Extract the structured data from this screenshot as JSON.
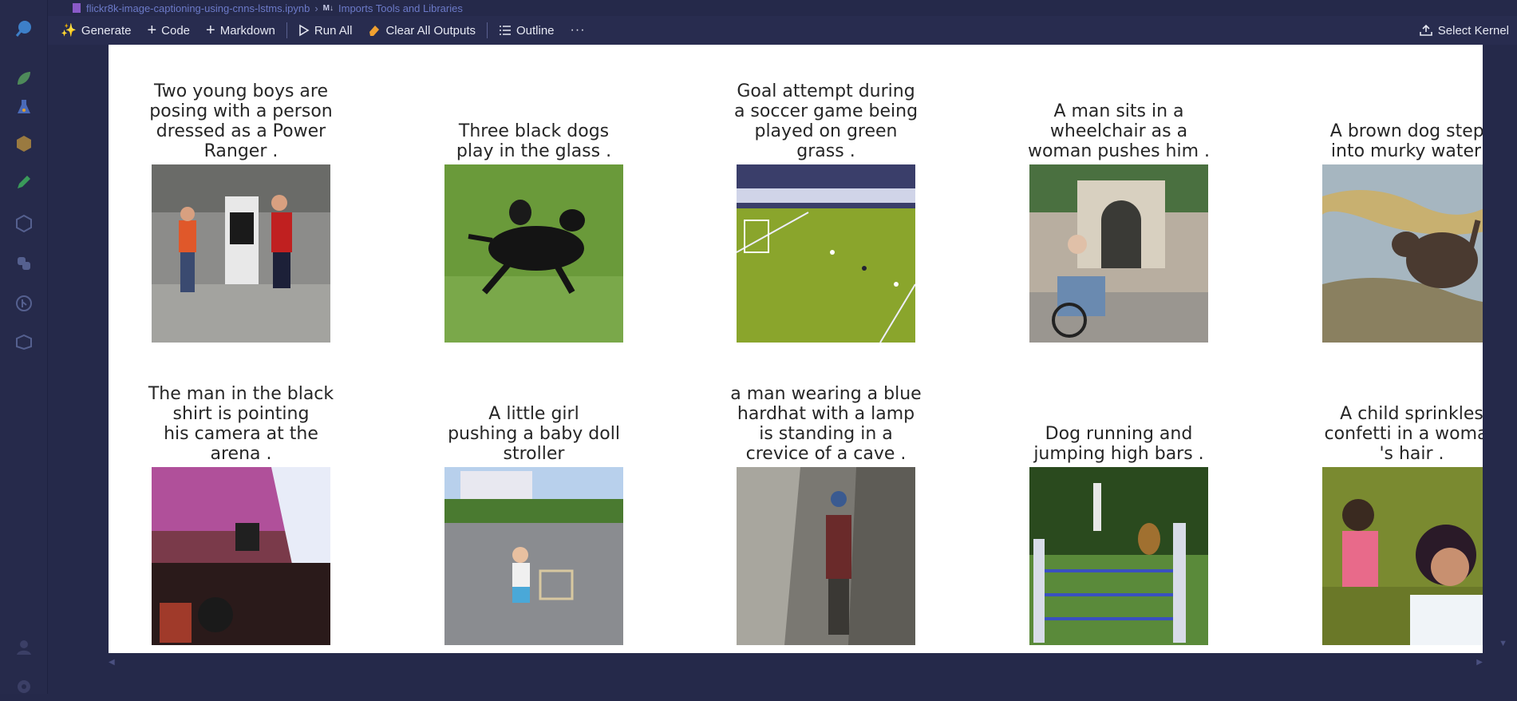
{
  "breadcrumb": {
    "file": "flickr8k-image-captioning-using-cnns-lstms.ipynb",
    "badge": "M↓",
    "section": "Imports Tools and Libraries"
  },
  "toolbar": {
    "generate": "Generate",
    "code": "Code",
    "markdown": "Markdown",
    "run_all": "Run All",
    "clear_outputs": "Clear All Outputs",
    "outline": "Outline",
    "more": "···",
    "select_kernel": "Select Kernel"
  },
  "captions": [
    "Two young boys are posing with a person dressed as a Power Ranger .",
    "Three black dogs play in the glass .",
    "Goal attempt during a soccer game being played on green grass .",
    "A man sits in a wheelchair as a woman pushes him .",
    "A brown dog steps into murky water .",
    "The man in the black shirt is pointing his camera at the arena .",
    "A little girl pushing a baby doll stroller",
    "a man wearing a blue hardhat with a lamp is standing in a crevice of a cave .",
    "Dog running and jumping high bars .",
    "A child sprinkles confetti in a woman 's hair ."
  ],
  "caption_lines": [
    [
      "Two young boys are",
      "posing with a person",
      "dressed as a Power",
      "Ranger ."
    ],
    [
      "Three black dogs",
      "play in the glass ."
    ],
    [
      "Goal attempt during",
      "a soccer game being",
      "played on green",
      "grass ."
    ],
    [
      "A man sits in a",
      "wheelchair as a",
      "woman pushes him ."
    ],
    [
      "A brown dog steps",
      "into murky water ."
    ],
    [
      "The man in the black",
      "shirt is pointing",
      "his camera at the",
      "arena ."
    ],
    [
      "A little girl",
      "pushing a baby doll",
      "stroller"
    ],
    [
      "a man wearing a blue",
      "hardhat with a lamp",
      "is standing in a",
      "crevice of a cave ."
    ],
    [
      "Dog running and",
      "jumping high bars ."
    ],
    [
      "A child sprinkles",
      "confetti in a woman",
      "'s hair ."
    ]
  ],
  "colors": {
    "sidebar": "#262a4b",
    "toolbar": "#282c4f",
    "output_bg": "#ffffff",
    "caption_text": "#262626",
    "breadcrumb_text": "#6c7ac8"
  }
}
